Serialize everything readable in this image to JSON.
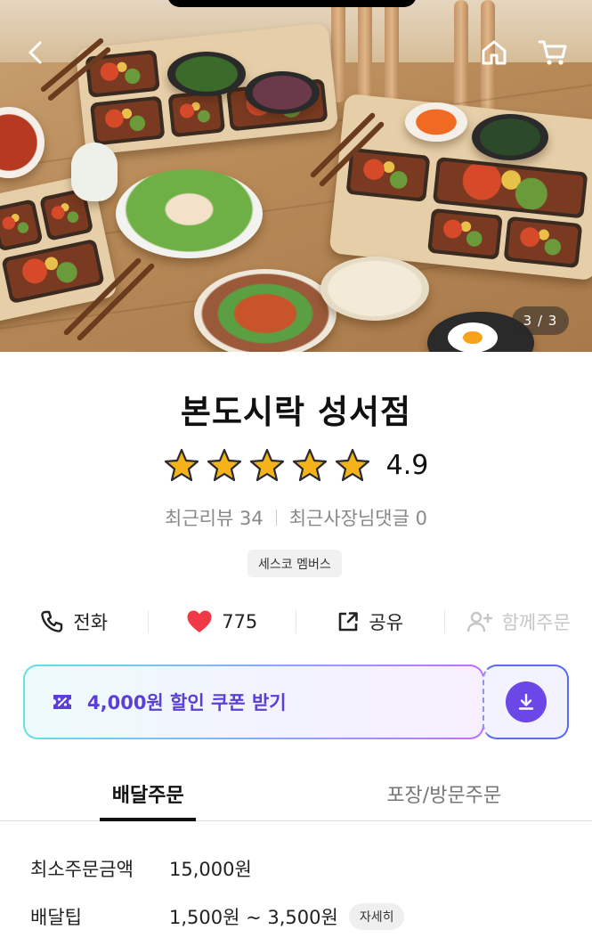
{
  "hero": {
    "pager": "3 / 3",
    "icons": [
      "back-arrow-icon",
      "home-icon",
      "cart-icon"
    ]
  },
  "store": {
    "name": "본도시락 성서점",
    "rating": "4.9",
    "star_count": 5,
    "star_color": "#f5b31b",
    "recent_reviews": "최근리뷰 34",
    "recent_owner_replies": "최근사장님댓글 0",
    "badge": "세스코 멤버스"
  },
  "actions": {
    "call": "전화",
    "likes": "775",
    "share": "공유",
    "group_order": "함께주문",
    "heart_color": "#f03a47"
  },
  "coupon": {
    "label": "4,000원 할인 쿠폰 받기",
    "accent": "#5a3fd9"
  },
  "tabs": [
    {
      "label": "배달주문",
      "active": true
    },
    {
      "label": "포장/방문주문",
      "active": false
    }
  ],
  "delivery": {
    "min_order_label": "최소주문금액",
    "min_order_value": "15,000원",
    "tip_label": "배달팁",
    "tip_value": "1,500원 ~ 3,500원",
    "detail_button": "자세히"
  }
}
